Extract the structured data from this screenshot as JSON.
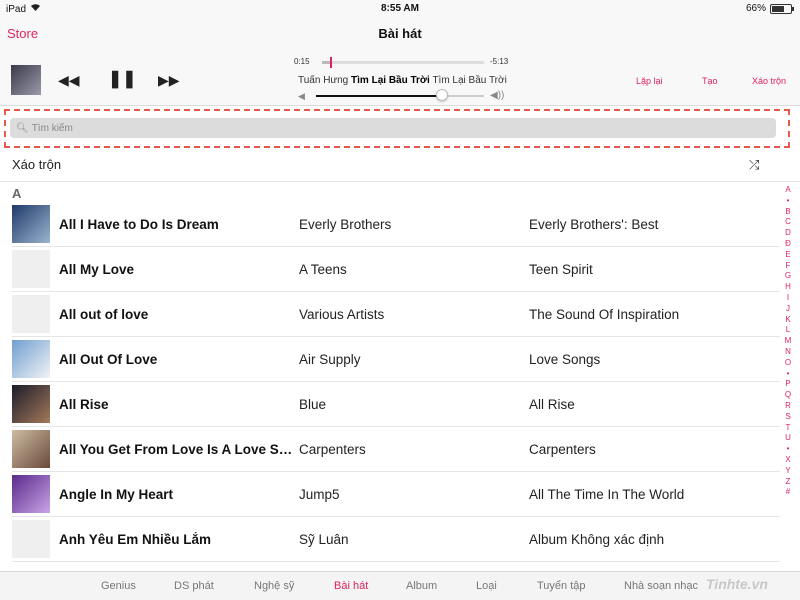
{
  "status_bar": {
    "device": "iPad",
    "time": "8:55 AM",
    "battery": "66%",
    "battery_level": 0.66
  },
  "nav": {
    "store": "Store",
    "title": "Bài hát"
  },
  "player": {
    "elapsed": "0:15",
    "remaining": "-5:13",
    "progress": 0.05,
    "volume": 0.75,
    "artist": "Tuấn Hưng",
    "song": "Tìm Lại Bầu Trời",
    "album": "Tìm Lại Bầu Trời",
    "repeat_label": "Lặp lại",
    "create_label": "Tạo",
    "shuffle_label": "Xáo trộn"
  },
  "search": {
    "placeholder": "Tìm kiếm"
  },
  "shuffle_row": {
    "label": "Xáo trộn"
  },
  "section": {
    "letter": "A"
  },
  "songs": [
    {
      "title": "All I Have to Do Is Dream",
      "artist": "Everly Brothers",
      "album": "Everly Brothers': Best",
      "art_colors": [
        "#1f3a6a",
        "#9bb4cf"
      ]
    },
    {
      "title": "All My Love",
      "artist": "A Teens",
      "album": "Teen Spirit",
      "art_colors": [
        "#efefef",
        "#efefef"
      ]
    },
    {
      "title": "All out of love",
      "artist": "Various Artists",
      "album": "The Sound Of Inspiration",
      "art_colors": [
        "#efefef",
        "#efefef"
      ]
    },
    {
      "title": "All Out Of Love",
      "artist": "Air Supply",
      "album": "Love Songs",
      "art_colors": [
        "#6f9fcf",
        "#f2f2f6"
      ]
    },
    {
      "title": "All Rise",
      "artist": "Blue",
      "album": "All Rise",
      "art_colors": [
        "#1b1b2a",
        "#a47a5a"
      ]
    },
    {
      "title": "All You Get From Love Is A Love Song",
      "artist": "Carpenters",
      "album": "Carpenters",
      "art_colors": [
        "#cdbca4",
        "#6a4a3a"
      ]
    },
    {
      "title": "Angle In My Heart",
      "artist": "Jump5",
      "album": "All The Time In The World",
      "art_colors": [
        "#5a2a8a",
        "#c8a4e8"
      ]
    },
    {
      "title": "Anh Yêu Em Nhiều Lắm",
      "artist": "Sỹ Luân",
      "album": "Album Không xác định",
      "art_colors": [
        "#efefef",
        "#efefef"
      ]
    }
  ],
  "alphabet": [
    "A",
    "•",
    "B",
    "C",
    "D",
    "Đ",
    "E",
    "F",
    "G",
    "H",
    "I",
    "J",
    "K",
    "L",
    "M",
    "N",
    "O",
    "•",
    "P",
    "Q",
    "R",
    "S",
    "T",
    "U",
    "•",
    "X",
    "Y",
    "Z",
    "#"
  ],
  "tabs": [
    {
      "label": "Genius",
      "active": false
    },
    {
      "label": "DS phát",
      "active": false
    },
    {
      "label": "Nghệ sỹ",
      "active": false
    },
    {
      "label": "Bài hát",
      "active": true
    },
    {
      "label": "Album",
      "active": false
    },
    {
      "label": "Loại",
      "active": false
    },
    {
      "label": "Tuyển tập",
      "active": false
    },
    {
      "label": "Nhà soạn nhạc",
      "active": false
    }
  ],
  "watermark": "Tinhte.vn",
  "accent_color": "#e0245e"
}
